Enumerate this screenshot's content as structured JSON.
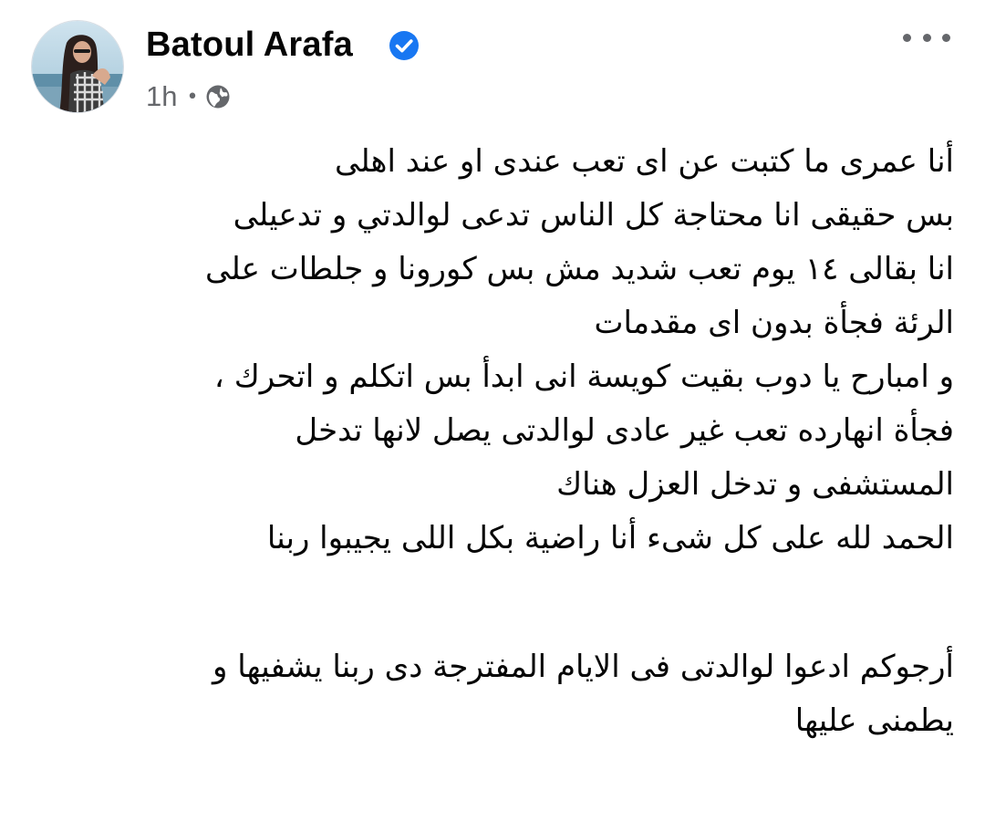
{
  "post": {
    "author": {
      "name": "Batoul Arafa",
      "verified": true,
      "avatar_icon": "profile-photo"
    },
    "meta": {
      "time": "1h",
      "separator": "•",
      "audience_icon": "globe-icon"
    },
    "more_icon": "more-dots-icon",
    "body_lines": [
      "أنا عمرى ما كتبت عن اى تعب عندى او عند اهلى",
      "بس حقيقى انا محتاجة كل الناس تدعى لوالدتي و تدعيلى",
      "انا بقالى ١٤ يوم تعب شديد مش بس كورونا و جلطات على",
      "الرئة فجأة بدون اى مقدمات",
      "و امبارح يا دوب بقيت كويسة انى ابدأ بس اتكلم و اتحرك ،",
      "فجأة انهارده تعب غير عادى لوالدتى يصل لانها تدخل",
      "المستشفى و تدخل العزل هناك",
      "الحمد لله على كل شىء أنا راضية بكل اللى يجيبوا ربنا",
      "",
      "أرجوكم ادعوا لوالدتى فى الايام المفترجة دى ربنا يشفيها و",
      "يطمنى عليها"
    ]
  },
  "colors": {
    "name": "#050505",
    "meta": "#65676b",
    "verified": "#1877f2",
    "background": "#ffffff"
  }
}
